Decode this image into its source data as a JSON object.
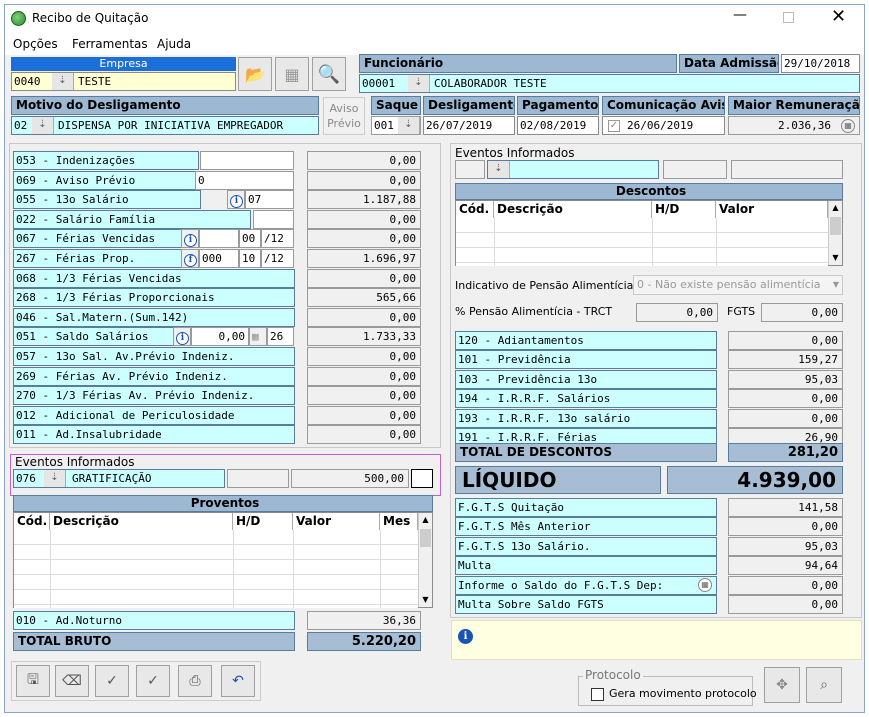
{
  "window": {
    "title": "Recibo de Quitação"
  },
  "menu": [
    "Opções",
    "Ferramentas",
    "Ajuda"
  ],
  "empresa": {
    "label": "Empresa",
    "code": "0040",
    "name": "TESTE"
  },
  "funcionario": {
    "label": "Funcionário",
    "code": "00001",
    "name": "COLABORADOR TESTE"
  },
  "admissao": {
    "label": "Data Admissão:",
    "date": "29/10/2018"
  },
  "motivo": {
    "label": "Motivo do Desligamento",
    "code": "02",
    "text": "DISPENSA POR INICIATIVA EMPREGADOR",
    "aviso_line1": "Aviso",
    "aviso_line2": "Prévio"
  },
  "saque": {
    "label": "Saque",
    "code": "001"
  },
  "desligamento": {
    "label": "Desligamento",
    "date": "26/07/2019"
  },
  "pagamento": {
    "label": "Pagamento",
    "date": "02/08/2019"
  },
  "comunicacao": {
    "label": "Comunicação Aviso",
    "date": "26/06/2019"
  },
  "maior": {
    "label": "Maior Remuneração",
    "value": "2.036,36"
  },
  "left_rows": [
    {
      "label": "053 - Indenizações",
      "value": "0,00"
    },
    {
      "label": "069 - Aviso Prévio",
      "extra": "0",
      "value": "0,00"
    },
    {
      "label": "055 - 13o Salário",
      "extra": "07",
      "value": "1.187,88"
    },
    {
      "label": "022 - Salário Família",
      "value": "0,00"
    },
    {
      "label": "067 - Férias Vencidas",
      "extra": "00",
      "extra2": "/12",
      "value": "0,00"
    },
    {
      "label": "267 - Férias Prop.",
      "extra0": "000",
      "extra": "10",
      "extra2": "/12",
      "value": "1.696,97"
    },
    {
      "label": "068 - 1/3 Férias Vencidas",
      "value": "0,00"
    },
    {
      "label": "268 - 1/3 Férias Proporcionais",
      "value": "565,66"
    },
    {
      "label": "046 - Sal.Matern.(Sum.142)",
      "value": "0,00"
    },
    {
      "label": "051 - Saldo Salários",
      "extra0": "0,00",
      "extra": "26",
      "value": "1.733,33"
    },
    {
      "label": "057 - 13o Sal. Av.Prévio Indeniz.",
      "value": "0,00"
    },
    {
      "label": "269 - Férias  Av. Prévio Indeniz.",
      "value": "0,00"
    },
    {
      "label": "270 - 1/3 Férias Av. Prévio Indeniz.",
      "value": "0,00"
    },
    {
      "label": "012 - Adicional de Periculosidade",
      "value": "0,00"
    },
    {
      "label": "011 - Ad.Insalubridade",
      "value": "0,00"
    }
  ],
  "eventos_left": {
    "label": "Eventos Informados",
    "code": "076",
    "name": "GRATIFICAÇÃO",
    "value": "500,00"
  },
  "proventos": {
    "title": "Proventos",
    "cols": [
      "Cód.",
      "Descrição",
      "H/D",
      "Valor",
      "Mes"
    ]
  },
  "ad_noturno": {
    "label": "010 - Ad.Noturno",
    "value": "36,36"
  },
  "total_bruto": {
    "label": "TOTAL BRUTO",
    "value": "5.220,20"
  },
  "eventos_right": {
    "label": "Eventos Informados"
  },
  "descontos": {
    "title": "Descontos",
    "cols": [
      "Cód.",
      "Descrição",
      "H/D",
      "Valor"
    ]
  },
  "pensao": {
    "label": "Indicativo de Pensão Alimentícia",
    "value": "0 - Não existe pensão alimentícia"
  },
  "pensao_pct": {
    "label": "% Pensão Alimentícia - TRCT",
    "value": "0,00",
    "fgts_label": "FGTS",
    "fgts_value": "0,00"
  },
  "right_rows": [
    {
      "label": "120 - Adiantamentos",
      "value": "0,00"
    },
    {
      "label": "101 - Previdência",
      "value": "159,27"
    },
    {
      "label": "103 - Previdência 13o",
      "value": "95,03"
    },
    {
      "label": "194 - I.R.R.F. Salários",
      "value": "0,00"
    },
    {
      "label": "193 - I.R.R.F. 13o salário",
      "value": "0,00"
    },
    {
      "label": "191 - I.R.R.F. Férias",
      "value": "26,90"
    }
  ],
  "total_descontos": {
    "label": "TOTAL DE DESCONTOS",
    "value": "281,20"
  },
  "liquido": {
    "label": "LÍQUIDO",
    "value": "4.939,00"
  },
  "fgts_rows": [
    {
      "label": "F.G.T.S  Quitação",
      "value": "141,58"
    },
    {
      "label": "F.G.T.S  Mês Anterior",
      "value": "0,00"
    },
    {
      "label": "F.G.T.S  13o Salário.",
      "value": "95,03"
    },
    {
      "label": "Multa",
      "value": "94,64"
    },
    {
      "label": "Informe o Saldo do F.G.T.S Dep:",
      "value": "0,00"
    },
    {
      "label": "Multa Sobre Saldo FGTS",
      "value": "0,00"
    }
  ],
  "protocolo": {
    "label": "Protocolo",
    "checkbox": "Gera movimento protocolo"
  }
}
